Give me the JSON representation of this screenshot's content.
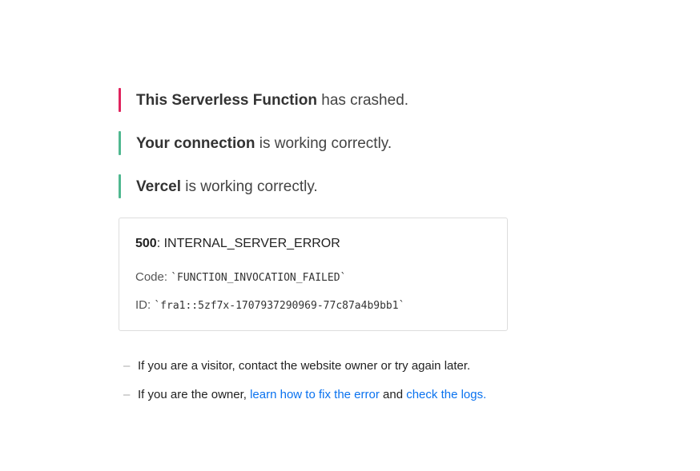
{
  "statuses": [
    {
      "bold": "This Serverless Function",
      "rest": " has crashed.",
      "color": "#e0245e"
    },
    {
      "bold": "Your connection",
      "rest": " is working correctly.",
      "color": "#50b890"
    },
    {
      "bold": "Vercel",
      "rest": " is working correctly.",
      "color": "#50b890"
    }
  ],
  "error": {
    "status_code": "500",
    "status_text": ": INTERNAL_SERVER_ERROR",
    "code_label": "Code: ",
    "code_value": "`FUNCTION_INVOCATION_FAILED`",
    "id_label": "ID: ",
    "id_value": "`fra1::5zf7x-1707937290969-77c87a4b9bb1`"
  },
  "help": {
    "dash": "–",
    "visitor_text": "If you are a visitor, contact the website owner or try again later.",
    "owner_prefix": "If you are the owner, ",
    "owner_link1": "learn how to fix the error",
    "owner_middle": " and ",
    "owner_link2": "check the logs",
    "owner_suffix": "."
  }
}
